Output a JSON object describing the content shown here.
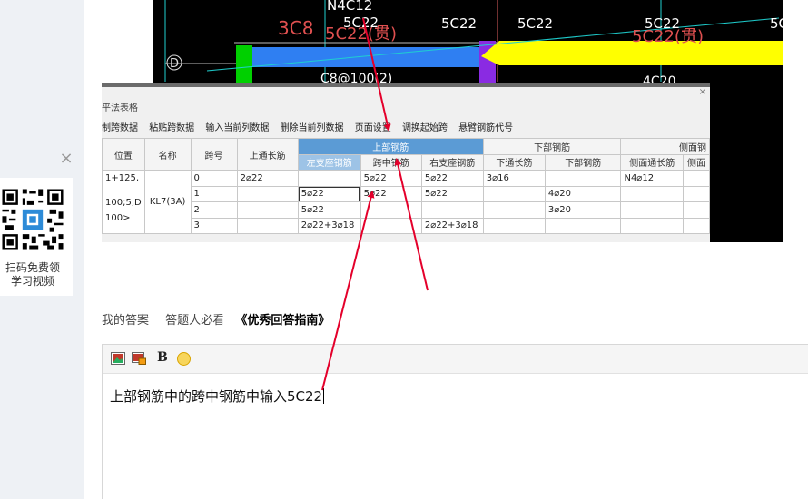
{
  "sidebar": {
    "close_label": "×",
    "qr_caption_line1": "扫码免费领",
    "qr_caption_line2": "学习视频"
  },
  "cad": {
    "labels": {
      "top_left": "N4C12",
      "red_mark": "3C8",
      "red_underline": "5C22(贯)",
      "c1": "5C22",
      "c2": "5C22",
      "c3": "5C22",
      "c4": "5C22",
      "c5": "5C",
      "c6": "5C22(贯)",
      "axis": "D",
      "bottom1": "C8@100(2)",
      "bottom2": "4C20"
    }
  },
  "dialog": {
    "title": "平法表格",
    "close": "×",
    "menu": [
      "制跨数据",
      "粘贴跨数据",
      "输入当前列数据",
      "删除当前列数据",
      "页面设置",
      "调换起始跨",
      "悬臂钢筋代号"
    ],
    "headers": {
      "position": "位置",
      "name": "名称",
      "span": "跨号",
      "top_through": "上通长筋",
      "top_rebar": "上部钢筋",
      "left_support": "左支座钢筋",
      "mid_span": "跨中钢筋",
      "right_support": "右支座钢筋",
      "bottom_rebar": "下部钢筋",
      "bottom_through": "下通长筋",
      "bottom": "下部钢筋",
      "side_rebar": "侧面钢",
      "side_through": "侧面通长筋",
      "side2": "侧面"
    },
    "position_text": [
      "1+125,",
      "100;5,D",
      "100>"
    ],
    "beam_name": "KL7(3A)",
    "rows": [
      {
        "span": "0",
        "top_through": "2⌀22",
        "left": "",
        "mid": "5⌀22",
        "right": "5⌀22",
        "bot_through": "3⌀16",
        "bottom": "",
        "side": "N4⌀12"
      },
      {
        "span": "1",
        "top_through": "",
        "left": "5⌀22",
        "mid": "5⌀22",
        "right": "5⌀22",
        "bot_through": "",
        "bottom": "4⌀20",
        "side": ""
      },
      {
        "span": "2",
        "top_through": "",
        "left": "5⌀22",
        "mid": "",
        "right": "",
        "bot_through": "",
        "bottom": "3⌀20",
        "side": ""
      },
      {
        "span": "3",
        "top_through": "",
        "left": "2⌀22+3⌀18",
        "mid": "",
        "right": "2⌀22+3⌀18",
        "bot_through": "",
        "bottom": "",
        "side": ""
      }
    ]
  },
  "answer": {
    "tab_my_answer": "我的答案",
    "tab_must_read": "答题人必看",
    "tab_guide": "《优秀回答指南》",
    "toolbar_bold": "B",
    "text": "上部钢筋中的跨中钢筋中输入5C22"
  },
  "colors": {
    "arrow": "#e4002b",
    "header_blue": "#5b9bd5",
    "cad_blue": "#2f7ff2",
    "cad_yellow": "#ffff00",
    "cad_green": "#00d000",
    "cad_purple": "#8a2be2"
  }
}
